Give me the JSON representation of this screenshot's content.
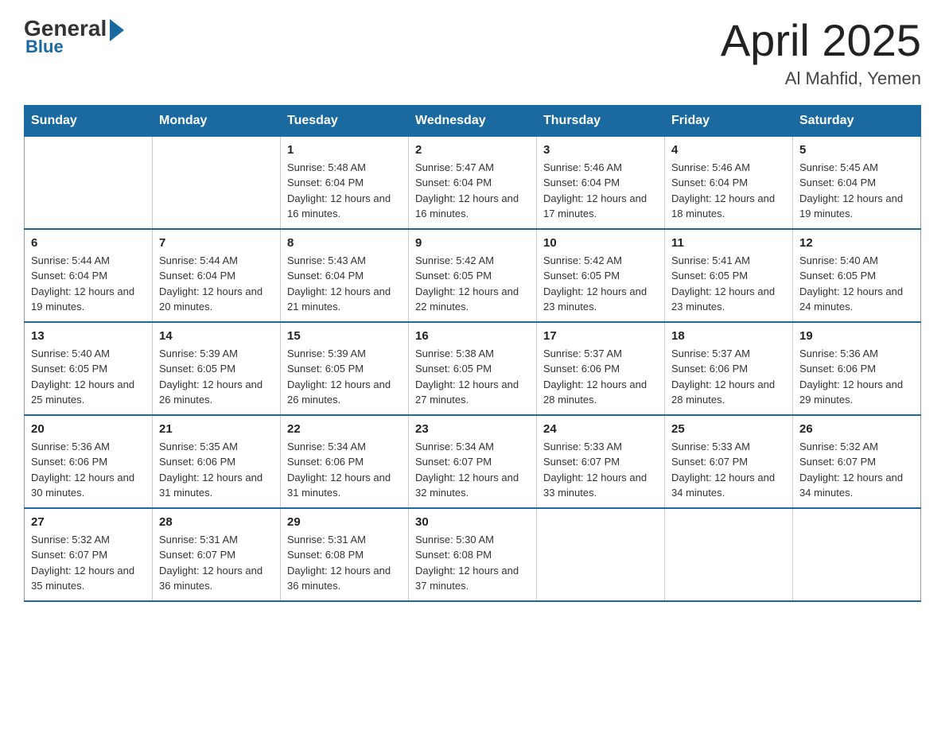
{
  "header": {
    "logo": {
      "general": "General",
      "blue": "Blue"
    },
    "title": "April 2025",
    "location": "Al Mahfid, Yemen"
  },
  "calendar": {
    "days_of_week": [
      "Sunday",
      "Monday",
      "Tuesday",
      "Wednesday",
      "Thursday",
      "Friday",
      "Saturday"
    ],
    "weeks": [
      [
        {
          "day": "",
          "info": ""
        },
        {
          "day": "",
          "info": ""
        },
        {
          "day": "1",
          "info": "Sunrise: 5:48 AM\nSunset: 6:04 PM\nDaylight: 12 hours and 16 minutes."
        },
        {
          "day": "2",
          "info": "Sunrise: 5:47 AM\nSunset: 6:04 PM\nDaylight: 12 hours and 16 minutes."
        },
        {
          "day": "3",
          "info": "Sunrise: 5:46 AM\nSunset: 6:04 PM\nDaylight: 12 hours and 17 minutes."
        },
        {
          "day": "4",
          "info": "Sunrise: 5:46 AM\nSunset: 6:04 PM\nDaylight: 12 hours and 18 minutes."
        },
        {
          "day": "5",
          "info": "Sunrise: 5:45 AM\nSunset: 6:04 PM\nDaylight: 12 hours and 19 minutes."
        }
      ],
      [
        {
          "day": "6",
          "info": "Sunrise: 5:44 AM\nSunset: 6:04 PM\nDaylight: 12 hours and 19 minutes."
        },
        {
          "day": "7",
          "info": "Sunrise: 5:44 AM\nSunset: 6:04 PM\nDaylight: 12 hours and 20 minutes."
        },
        {
          "day": "8",
          "info": "Sunrise: 5:43 AM\nSunset: 6:04 PM\nDaylight: 12 hours and 21 minutes."
        },
        {
          "day": "9",
          "info": "Sunrise: 5:42 AM\nSunset: 6:05 PM\nDaylight: 12 hours and 22 minutes."
        },
        {
          "day": "10",
          "info": "Sunrise: 5:42 AM\nSunset: 6:05 PM\nDaylight: 12 hours and 23 minutes."
        },
        {
          "day": "11",
          "info": "Sunrise: 5:41 AM\nSunset: 6:05 PM\nDaylight: 12 hours and 23 minutes."
        },
        {
          "day": "12",
          "info": "Sunrise: 5:40 AM\nSunset: 6:05 PM\nDaylight: 12 hours and 24 minutes."
        }
      ],
      [
        {
          "day": "13",
          "info": "Sunrise: 5:40 AM\nSunset: 6:05 PM\nDaylight: 12 hours and 25 minutes."
        },
        {
          "day": "14",
          "info": "Sunrise: 5:39 AM\nSunset: 6:05 PM\nDaylight: 12 hours and 26 minutes."
        },
        {
          "day": "15",
          "info": "Sunrise: 5:39 AM\nSunset: 6:05 PM\nDaylight: 12 hours and 26 minutes."
        },
        {
          "day": "16",
          "info": "Sunrise: 5:38 AM\nSunset: 6:05 PM\nDaylight: 12 hours and 27 minutes."
        },
        {
          "day": "17",
          "info": "Sunrise: 5:37 AM\nSunset: 6:06 PM\nDaylight: 12 hours and 28 minutes."
        },
        {
          "day": "18",
          "info": "Sunrise: 5:37 AM\nSunset: 6:06 PM\nDaylight: 12 hours and 28 minutes."
        },
        {
          "day": "19",
          "info": "Sunrise: 5:36 AM\nSunset: 6:06 PM\nDaylight: 12 hours and 29 minutes."
        }
      ],
      [
        {
          "day": "20",
          "info": "Sunrise: 5:36 AM\nSunset: 6:06 PM\nDaylight: 12 hours and 30 minutes."
        },
        {
          "day": "21",
          "info": "Sunrise: 5:35 AM\nSunset: 6:06 PM\nDaylight: 12 hours and 31 minutes."
        },
        {
          "day": "22",
          "info": "Sunrise: 5:34 AM\nSunset: 6:06 PM\nDaylight: 12 hours and 31 minutes."
        },
        {
          "day": "23",
          "info": "Sunrise: 5:34 AM\nSunset: 6:07 PM\nDaylight: 12 hours and 32 minutes."
        },
        {
          "day": "24",
          "info": "Sunrise: 5:33 AM\nSunset: 6:07 PM\nDaylight: 12 hours and 33 minutes."
        },
        {
          "day": "25",
          "info": "Sunrise: 5:33 AM\nSunset: 6:07 PM\nDaylight: 12 hours and 34 minutes."
        },
        {
          "day": "26",
          "info": "Sunrise: 5:32 AM\nSunset: 6:07 PM\nDaylight: 12 hours and 34 minutes."
        }
      ],
      [
        {
          "day": "27",
          "info": "Sunrise: 5:32 AM\nSunset: 6:07 PM\nDaylight: 12 hours and 35 minutes."
        },
        {
          "day": "28",
          "info": "Sunrise: 5:31 AM\nSunset: 6:07 PM\nDaylight: 12 hours and 36 minutes."
        },
        {
          "day": "29",
          "info": "Sunrise: 5:31 AM\nSunset: 6:08 PM\nDaylight: 12 hours and 36 minutes."
        },
        {
          "day": "30",
          "info": "Sunrise: 5:30 AM\nSunset: 6:08 PM\nDaylight: 12 hours and 37 minutes."
        },
        {
          "day": "",
          "info": ""
        },
        {
          "day": "",
          "info": ""
        },
        {
          "day": "",
          "info": ""
        }
      ]
    ]
  }
}
